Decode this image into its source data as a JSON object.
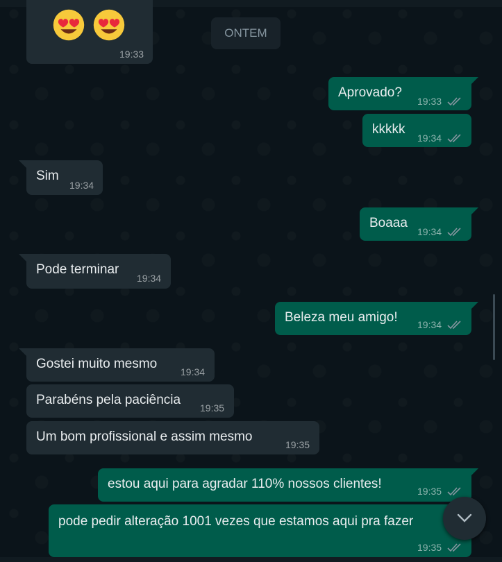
{
  "date_chip": "ONTEM",
  "emoji_message": {
    "time": "19:33"
  },
  "messages": [
    {
      "text": "Aprovado?",
      "time": "19:33",
      "direction": "outgoing"
    },
    {
      "text": "kkkkk",
      "time": "19:34",
      "direction": "outgoing"
    },
    {
      "text": "Sim",
      "time": "19:34",
      "direction": "incoming"
    },
    {
      "text": "Boaaa",
      "time": "19:34",
      "direction": "outgoing"
    },
    {
      "text": "Pode terminar",
      "time": "19:34",
      "direction": "incoming"
    },
    {
      "text": "Beleza meu amigo!",
      "time": "19:34",
      "direction": "outgoing"
    },
    {
      "text": "Gostei muito mesmo",
      "time": "19:34",
      "direction": "incoming"
    },
    {
      "text": "Parabéns pela paciência",
      "time": "19:35",
      "direction": "incoming"
    },
    {
      "text": "Um bom profissional e assim mesmo",
      "time": "19:35",
      "direction": "incoming"
    },
    {
      "text": "estou aqui para agradar 110% nossos clientes!",
      "time": "19:35",
      "direction": "outgoing"
    },
    {
      "text": "pode pedir alteração 1001 vezes que estamos aqui pra fazer",
      "time": "19:35",
      "direction": "outgoing"
    }
  ],
  "colors": {
    "background": "#0b141a",
    "incoming_bubble": "#202c33",
    "outgoing_bubble": "#005c4b",
    "read_ticks": "#8696a0"
  },
  "icons": [
    "heart-eyes-emoji",
    "double-check-icon",
    "chevron-down-icon"
  ]
}
